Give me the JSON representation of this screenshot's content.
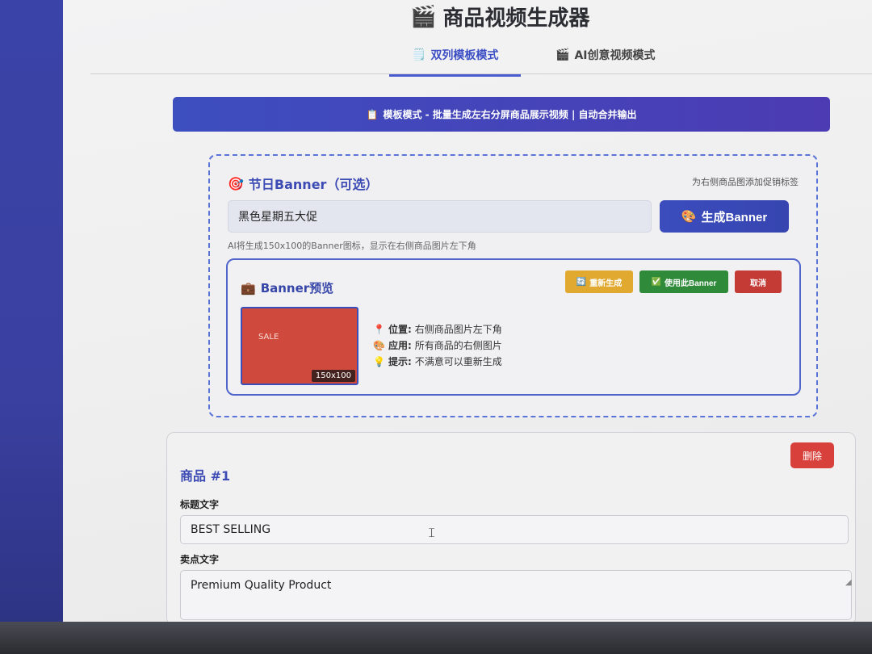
{
  "app": {
    "title": "商品视频生成器",
    "title_icon": "clapper-icon"
  },
  "tabs": [
    {
      "label": "双列模板模式",
      "icon": "notepad-icon",
      "active": true
    },
    {
      "label": "AI创意视频模式",
      "icon": "clapper-icon",
      "active": false
    }
  ],
  "mode_banner": {
    "icon": "clipboard-icon",
    "text": "模板模式 - 批量生成左右分屏商品展示视频 | 自动合并输出"
  },
  "banner_section": {
    "icon": "target-icon",
    "title": "节日Banner（可选）",
    "hint": "为右侧商品图添加促销标签",
    "input_value": "黑色星期五大促",
    "generate_label": "生成Banner",
    "generate_icon": "palette-icon",
    "help_text": "AI将生成150x100的Banner图标，显示在右侧商品图片左下角"
  },
  "preview": {
    "icon": "briefcase-icon",
    "title": "Banner预览",
    "regen_label": "重新生成",
    "use_label": "使用此Banner",
    "cancel_label": "取消",
    "thumb_text": "SALE",
    "size_tag": "150x100",
    "info": [
      {
        "icon": "pin-icon",
        "key": "位置:",
        "value": "右侧商品图片左下角"
      },
      {
        "icon": "palette-icon",
        "key": "应用:",
        "value": "所有商品的右侧图片"
      },
      {
        "icon": "bulb-icon",
        "key": "提示:",
        "value": "不满意可以重新生成"
      }
    ]
  },
  "product": {
    "title": "商品 #1",
    "delete_label": "删除",
    "title_label": "标题文字",
    "title_value": "BEST SELLING",
    "selling_label": "卖点文字",
    "selling_value": "Premium Quality Product"
  },
  "colors": {
    "accent": "#3d4fc4",
    "banner_red": "#cf4a3d",
    "regen": "#e1a930",
    "use": "#2f8a3a",
    "cancel": "#c43a35"
  }
}
